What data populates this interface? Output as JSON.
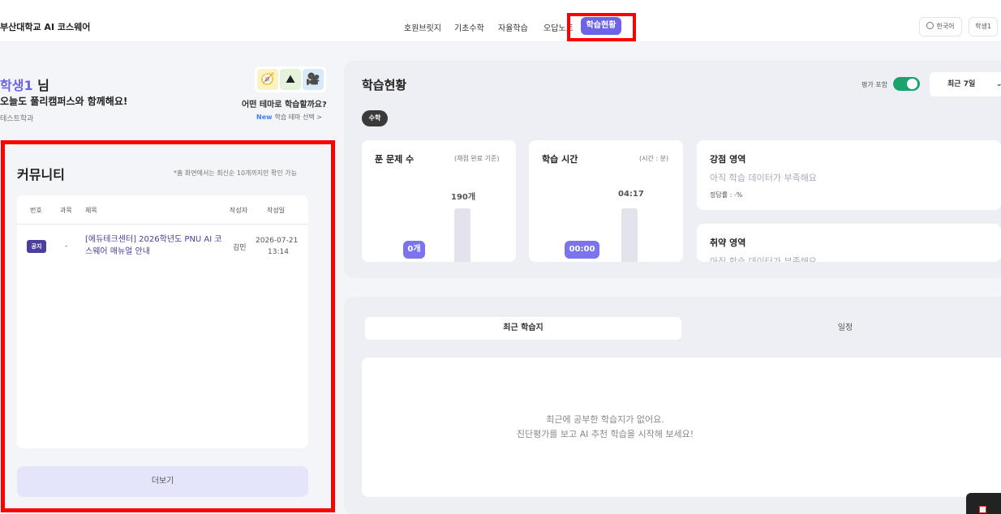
{
  "header": {
    "brand": "부산대학교 AI 코스웨어",
    "nav": [
      "호원브릿지",
      "기초수학",
      "자율학습",
      "오답노트"
    ],
    "nav_active": "학습현황",
    "lang": "한국어",
    "user": "학생1"
  },
  "profile": {
    "name": "학생1",
    "suffix": " 님",
    "greeting": "오늘도 풀리캠퍼스와 함께해요!",
    "dept": "테스트학과",
    "theme_question": "어떤 테마로 학습할까요?",
    "theme_new": "New",
    "theme_link": "학습 테마 선택 >",
    "theme_icons": [
      "compass-icon",
      "mountain-icon",
      "camera-icon"
    ]
  },
  "community": {
    "title": "커뮤니티",
    "note": "*홈 화면에서는 최신순 10개까지만 확인 가능",
    "headers": [
      "번호",
      "과목",
      "제목",
      "작성자",
      "작성일"
    ],
    "rows": [
      {
        "badge": "공지",
        "subject": "-",
        "title": "[에듀테크센터] 2026학년도 PNU AI 코스웨어 매뉴얼 안내",
        "author": "김민",
        "date": "2026-07-21",
        "time": "13:14"
      }
    ],
    "more": "더보기"
  },
  "status": {
    "title": "학습현황",
    "eval_label": "평가 포함",
    "toggle_on": true,
    "period": "최근 7일",
    "subject": "수학",
    "solved": {
      "title": "푼 문제 수",
      "note": "(채점 완료 기준)",
      "ref_value": "190개",
      "my_value": "0개"
    },
    "time": {
      "title": "학습 시간",
      "note": "(시간 : 분)",
      "ref_value": "04:17",
      "my_value": "00:00"
    },
    "strong": {
      "title": "강점 영역",
      "sub": "아직 학습 데이터가 부족해요",
      "rate": "정답률 : -%"
    },
    "weak": {
      "title": "취약 영역",
      "sub": "아직 학습 데이터가 부족해요"
    }
  },
  "lower": {
    "tab_active": "최근 학습지",
    "tab_other": "일정",
    "empty_line1": "최근에 공부한 학습지가 없어요.",
    "empty_line2": "진단평가를 보고 AI 추천 학습을 시작해 보세요!"
  },
  "colors": {
    "accent": "#6c63e8",
    "highlight": "#ff0000",
    "toggle": "#1aa36b"
  }
}
